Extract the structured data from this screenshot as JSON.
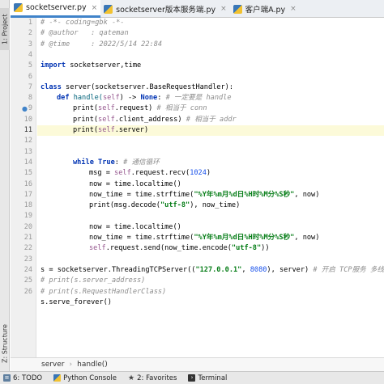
{
  "left_strip": {
    "project_tab": "1: Project",
    "structure_tab": "Z: Structure"
  },
  "tabs": [
    {
      "label": "socketserver.py",
      "active": true
    },
    {
      "label": "socketserver版本服务端.py",
      "active": false
    },
    {
      "label": "客户端A.py",
      "active": false
    }
  ],
  "tab_close_glyph": "×",
  "line_numbers": [
    "1",
    "2",
    "3",
    "4",
    "5",
    "6",
    "7",
    "8",
    "9",
    "10",
    "11",
    "12",
    "13",
    "14",
    "15",
    "16",
    "17",
    "18",
    "19",
    "20",
    "21",
    "22",
    "23",
    "24",
    "25",
    "26"
  ],
  "code": {
    "l1": "# -*- coding=gbk -*-",
    "l2": "# @author   : qateman",
    "l3": "# @time     : 2022/5/14 22:84",
    "l5_kw": "import",
    "l5_rest": " socketserver,time",
    "l7_kw": "class",
    "l7_rest": " server(socketserver.BaseRequestHandler):",
    "l8_kw": "def",
    "l8_name": " handle(",
    "l8_self": "self",
    "l8_arrow": ") -> ",
    "l8_none": "None",
    "l8_colon": ": ",
    "l8_cm": "# 一定要是 handle",
    "l9_pre": "print(",
    "l9_self": "self",
    "l9_post": ".request) ",
    "l9_cm": "# 相当于 conn",
    "l10_pre": "print(",
    "l10_self": "self",
    "l10_post": ".client_address) ",
    "l10_cm": "# 相当于 addr",
    "l11_pre": "print(",
    "l11_self": "self",
    "l11_post": ".server)",
    "l13_kw": "while",
    "l13_true": " True",
    "l13_colon": ": ",
    "l13_cm": "# 通信循环",
    "l14_pre": "msg = ",
    "l14_self": "self",
    "l14_mid": ".request.recv(",
    "l14_num": "1024",
    "l14_post": ")",
    "l15": "now = time.localtime()",
    "l16_pre": "now_time = time.strftime(",
    "l16_str": "\"%Y年%m月%d日%H时%M分%S秒\"",
    "l16_post": ", now)",
    "l17_pre": "print(msg.decode(",
    "l17_str": "\"utf-8\"",
    "l17_post": "), now_time)",
    "l19": "now = time.localtime()",
    "l20_pre": "now_time = time.strftime(",
    "l20_str": "\"%Y年%m月%d日%H时%M分%S秒\"",
    "l20_post": ", now)",
    "l21_self": "self",
    "l21_mid": ".request.send(now_time.encode(",
    "l21_str": "\"utf-8\"",
    "l21_post": "))",
    "l23_pre": "s = socketserver.ThreadingTCPServer((",
    "l23_str": "\"127.0.0.1\"",
    "l23_mid": ", ",
    "l23_num": "8080",
    "l23_post": "), server) ",
    "l23_cm": "# 开启 TCP服务 多线程",
    "l24": "# print(s.server_address)",
    "l25": "# print(s.RequestHandlerClass)",
    "l26": "s.serve_forever()"
  },
  "breadcrumb": {
    "item1": "server",
    "sep": "›",
    "item2": "handle()"
  },
  "bottom_tools": [
    {
      "label": "6: TODO",
      "icon": "list-icon",
      "color": "#5f7f9f"
    },
    {
      "label": "Python Console",
      "icon": "python-icon",
      "color": "#3a77b7"
    },
    {
      "label": "2: Favorites",
      "icon": "star-icon",
      "color": "#444444"
    },
    {
      "label": "Terminal",
      "icon": "terminal-icon",
      "color": "#333333"
    }
  ]
}
